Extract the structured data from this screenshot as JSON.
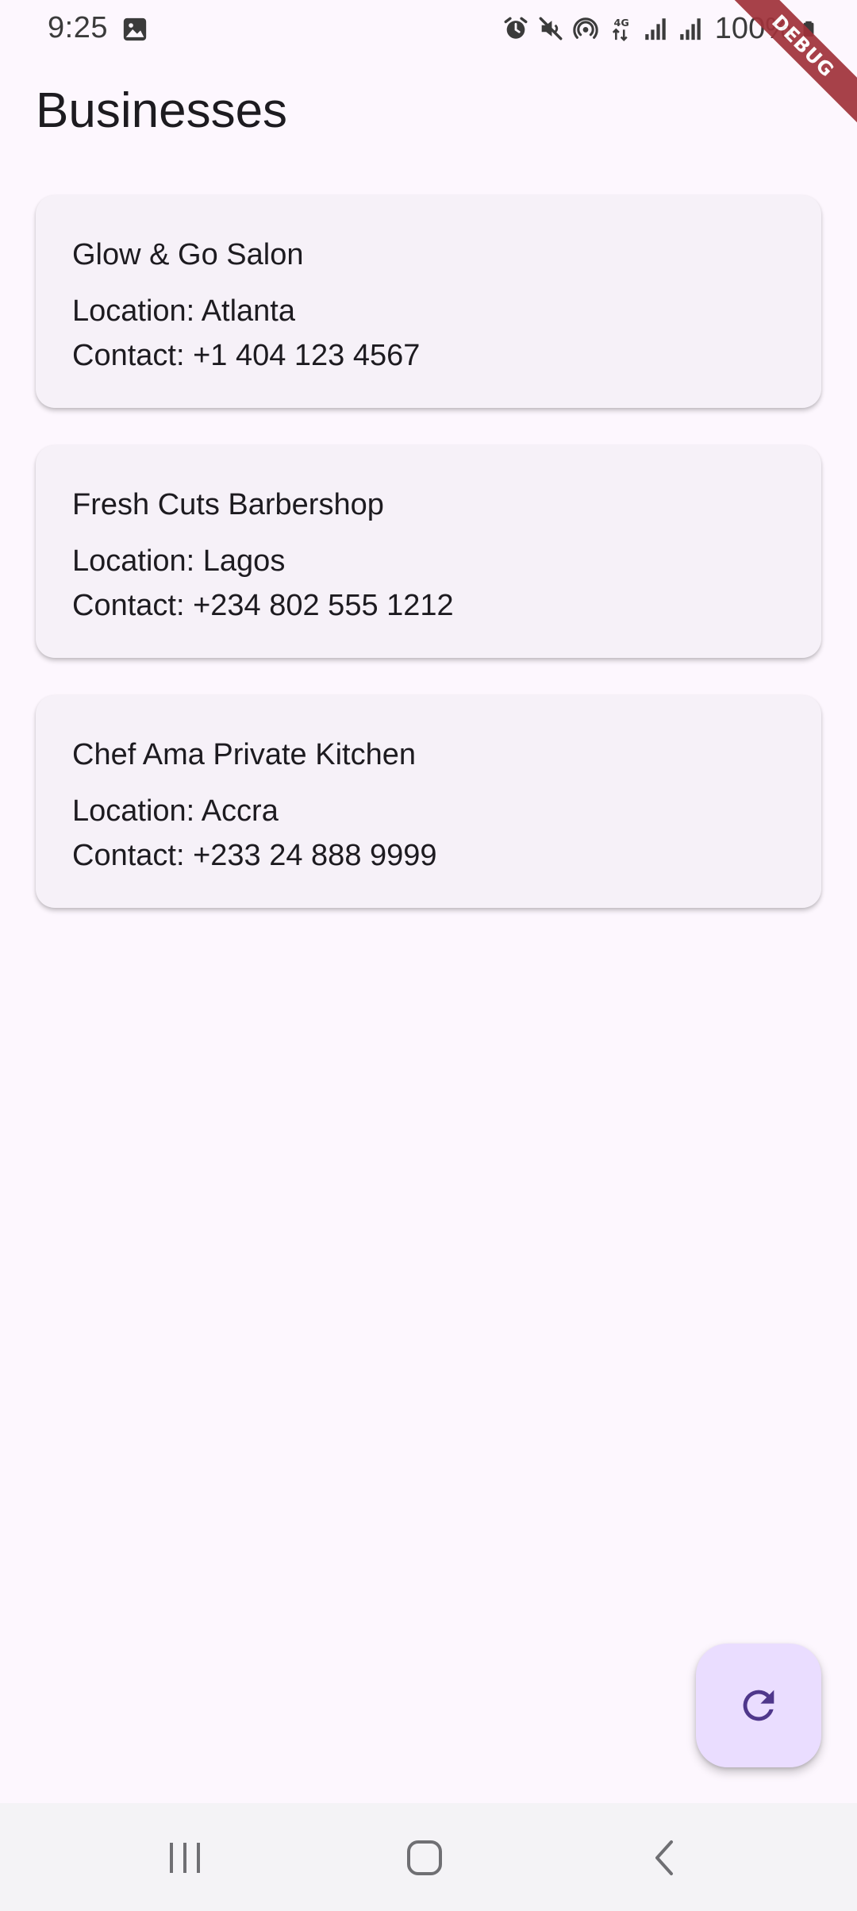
{
  "status_bar": {
    "time": "9:25",
    "battery": "100%",
    "icons": [
      "gallery-icon",
      "alarm-icon",
      "mute-icon",
      "hotspot-icon",
      "network-4g-icon",
      "signal-icon",
      "signal-icon",
      "battery-icon"
    ]
  },
  "debug_banner": {
    "label": "DEBUG"
  },
  "app_bar": {
    "title": "Businesses"
  },
  "businesses": [
    {
      "name": "Glow & Go Salon",
      "location": "Location: Atlanta",
      "contact": "Contact: +1 404 123 4567"
    },
    {
      "name": "Fresh Cuts Barbershop",
      "location": "Location: Lagos",
      "contact": "Contact: +234 802 555 1212"
    },
    {
      "name": "Chef Ama Private Kitchen",
      "location": "Location: Accra",
      "contact": "Contact: +233 24 888 9999"
    }
  ],
  "fab": {
    "icon": "refresh-icon"
  },
  "nav_bar": {
    "buttons": [
      "recents-icon",
      "home-icon",
      "back-icon"
    ]
  },
  "colors": {
    "background": "#fdf7fe",
    "card": "#f6f1f8",
    "fab": "#eaddff",
    "fab_icon": "#4f378b",
    "debug": "#a0323a",
    "text": "#1d1b20"
  }
}
